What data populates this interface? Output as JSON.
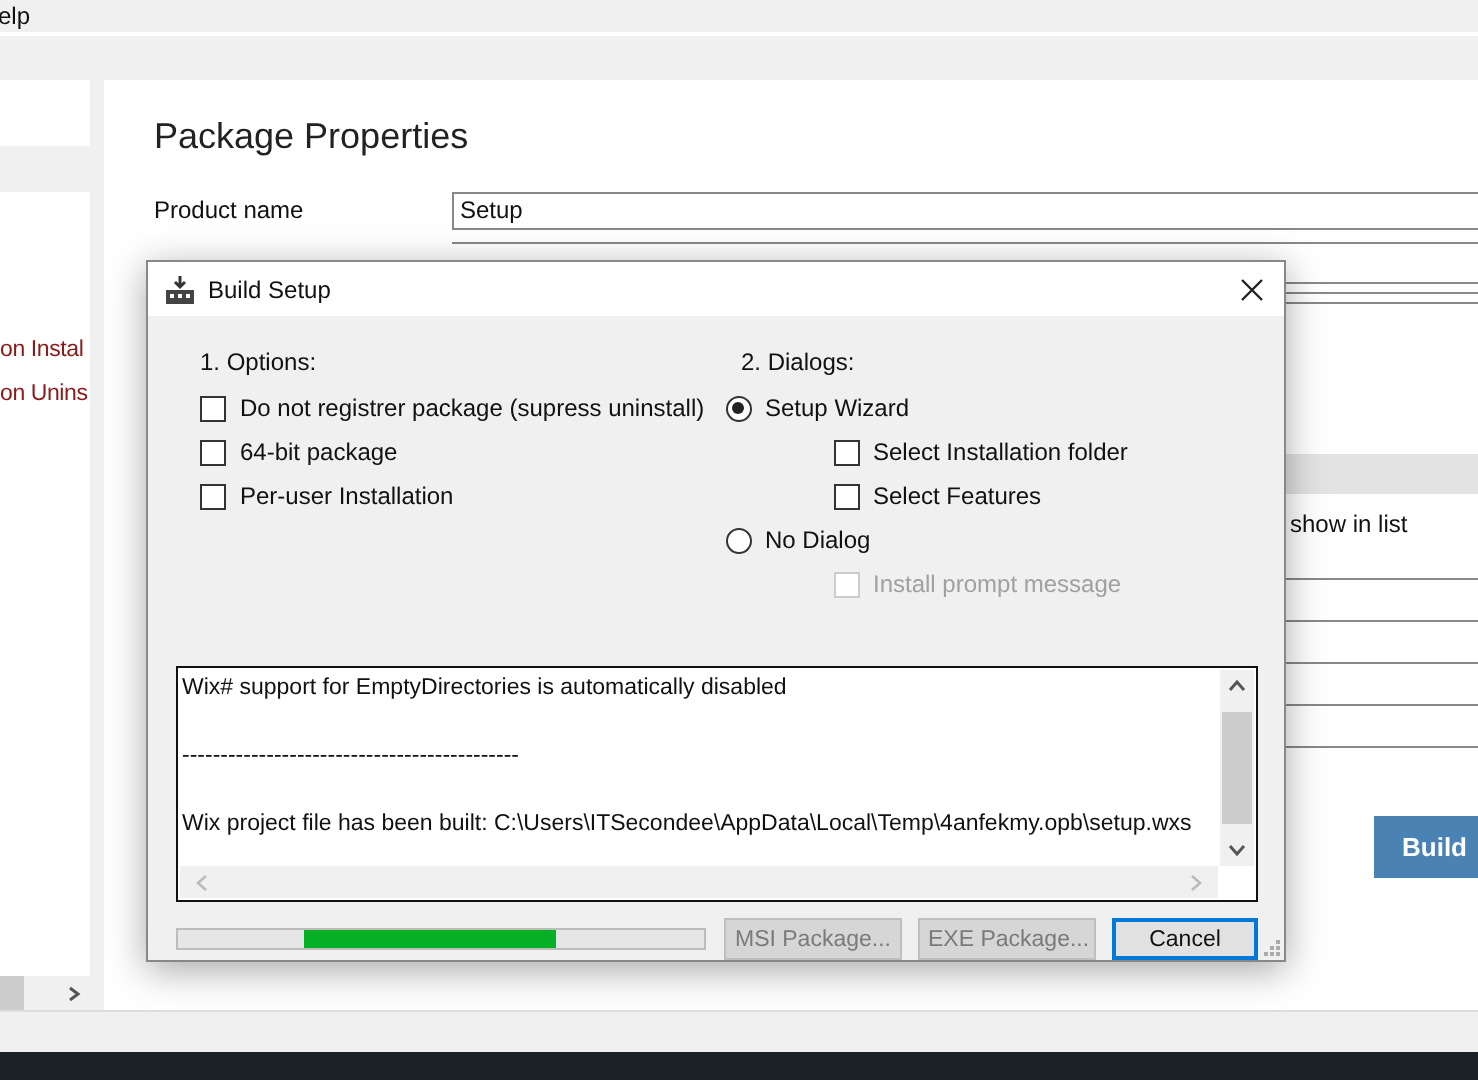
{
  "app": {
    "menu": [
      "elp"
    ],
    "sidebar": {
      "items": [
        {
          "label": "on Instal"
        },
        {
          "label": "on Unins"
        }
      ]
    },
    "main": {
      "title": "Package Properties",
      "fields": [
        {
          "label": "Product name",
          "value": "Setup"
        }
      ],
      "option_label": "show in list",
      "build_button": "Build"
    }
  },
  "dialog": {
    "title": "Build Setup",
    "options": {
      "heading": "1. Options:",
      "items": [
        {
          "label": "Do not registrer package (supress uninstall)",
          "checked": false
        },
        {
          "label": "64-bit package",
          "checked": false
        },
        {
          "label": "Per-user Installation",
          "checked": false
        }
      ]
    },
    "dialogs": {
      "heading": "2. Dialogs:",
      "items": [
        {
          "label": "Setup Wizard",
          "selected": true,
          "children": [
            {
              "label": "Select Installation folder",
              "checked": false,
              "disabled": false
            },
            {
              "label": "Select Features",
              "checked": false,
              "disabled": false
            }
          ]
        },
        {
          "label": "No Dialog",
          "selected": false,
          "children": [
            {
              "label": "Install prompt message",
              "checked": false,
              "disabled": true
            }
          ]
        }
      ]
    },
    "log": [
      "Wix# support for EmptyDirectories is automatically disabled",
      "--------------------------------------------",
      "Wix project file has been built: C:\\Users\\ITSecondee\\AppData\\Local\\Temp\\4anfekmy.opb\\setup.wxs"
    ],
    "progress": {
      "level": 0.48
    },
    "buttons": [
      {
        "label": "MSI Package...",
        "disabled": true,
        "focused": false
      },
      {
        "label": "EXE Package...",
        "disabled": true,
        "focused": false
      },
      {
        "label": "Cancel",
        "disabled": false,
        "focused": true
      }
    ]
  }
}
